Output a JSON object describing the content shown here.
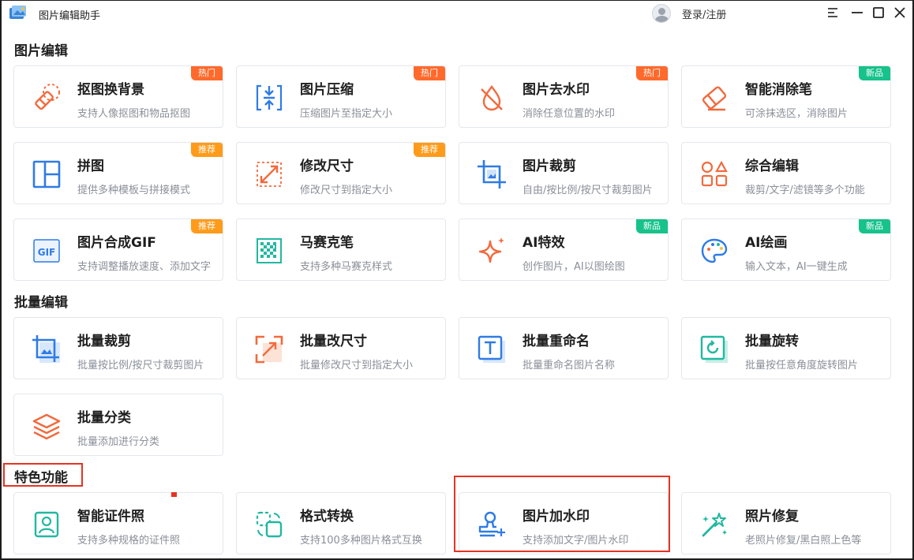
{
  "window": {
    "title": "图片编辑助手",
    "login_label": "登录/注册",
    "controls": [
      "menu",
      "minimize",
      "maximize",
      "close"
    ]
  },
  "sections": [
    {
      "title": "图片编辑"
    },
    {
      "title": "批量编辑"
    },
    {
      "title": "特色功能"
    }
  ],
  "cards": [
    {
      "name": "抠图换背景",
      "desc": "支持人像抠图和物品抠图",
      "badge": "热门",
      "icon": "eraser-icon"
    },
    {
      "name": "图片压缩",
      "desc": "压缩图片至指定大小",
      "badge": "热门",
      "icon": "compress-icon"
    },
    {
      "name": "图片去水印",
      "desc": "消除任意位置的水印",
      "badge": "热门",
      "icon": "no-watermark-icon"
    },
    {
      "name": "智能消除笔",
      "desc": "可涂抹选区，消除图片",
      "badge": "新品",
      "icon": "smart-eraser-icon"
    },
    {
      "name": "拼图",
      "desc": "提供多种模板与拼接模式",
      "badge": "推荐",
      "icon": "collage-icon"
    },
    {
      "name": "修改尺寸",
      "desc": "修改尺寸到指定大小",
      "badge": "推荐",
      "icon": "resize-icon"
    },
    {
      "name": "图片裁剪",
      "desc": "自由/按比例/按尺寸裁剪图片",
      "badge": "",
      "icon": "crop-icon"
    },
    {
      "name": "综合编辑",
      "desc": "裁剪/文字/滤镜等多个功能",
      "badge": "",
      "icon": "shapes-icon"
    },
    {
      "name": "图片合成GIF",
      "desc": "支持调整播放速度、添加文字",
      "badge": "推荐",
      "icon": "gif-icon"
    },
    {
      "name": "马赛克笔",
      "desc": "支持多种马赛克样式",
      "badge": "",
      "icon": "mosaic-icon"
    },
    {
      "name": "AI特效",
      "desc": "创作图片，AI以图绘图",
      "badge": "新品",
      "icon": "sparkle-icon"
    },
    {
      "name": "AI绘画",
      "desc": "输入文本，AI一键生成",
      "badge": "新品",
      "icon": "palette-icon"
    },
    {
      "name": "批量裁剪",
      "desc": "批量按比例/按尺寸裁剪图片",
      "badge": "",
      "icon": "batch-crop-icon"
    },
    {
      "name": "批量改尺寸",
      "desc": "批量修改尺寸到指定大小",
      "badge": "",
      "icon": "batch-resize-icon"
    },
    {
      "name": "批量重命名",
      "desc": "批量重命名图片名称",
      "badge": "",
      "icon": "batch-rename-icon"
    },
    {
      "name": "批量旋转",
      "desc": "批量按任意角度旋转图片",
      "badge": "",
      "icon": "batch-rotate-icon"
    },
    {
      "name": "批量分类",
      "desc": "批量添加进行分类",
      "badge": "",
      "icon": "layers-icon"
    },
    {
      "name": "智能证件照",
      "desc": "支持多种规格的证件照",
      "badge": "",
      "icon": "id-photo-icon"
    },
    {
      "name": "格式转换",
      "desc": "支持100多种图片格式互换",
      "badge": "",
      "icon": "format-convert-icon"
    },
    {
      "name": "图片加水印",
      "desc": "支持添加文字/图片水印",
      "badge": "",
      "icon": "stamp-icon"
    },
    {
      "name": "照片修复",
      "desc": "老照片修复/黑白照上色等",
      "badge": "",
      "icon": "magic-wand-icon"
    }
  ],
  "colors": {
    "accent_orange": "#f26a3d",
    "accent_blue": "#2f7be5",
    "accent_teal": "#22b8a0",
    "badge_hot": "#ff6a2c",
    "badge_recommend": "#ff9b1a",
    "badge_new": "#17c28b",
    "highlight_red": "#e53322"
  }
}
